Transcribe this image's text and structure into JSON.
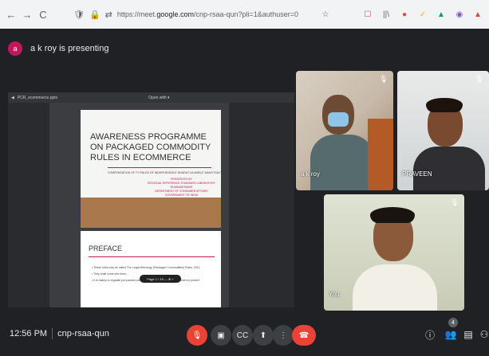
{
  "browser": {
    "url_prefix": "https://meet.",
    "url_domain": "google.com",
    "url_suffix": "/cnp-rsaa-qun?pli=1&authuser=0",
    "back_glyph": "←",
    "forward_glyph": "→",
    "reload_glyph": "C",
    "star_glyph": "☆",
    "extensions": [
      {
        "name": "pocket",
        "glyph": "☐",
        "color": "#d0465a"
      },
      {
        "name": "library",
        "glyph": "||\\",
        "color": "#5f6368"
      },
      {
        "name": "extension-1",
        "glyph": "●",
        "color": "#e8453c"
      },
      {
        "name": "extension-2",
        "glyph": "✓",
        "color": "#f4b400"
      },
      {
        "name": "extension-3",
        "glyph": "▲",
        "color": "#0f9d58"
      },
      {
        "name": "extension-4",
        "glyph": "◉",
        "color": "#7e57c2"
      },
      {
        "name": "extension-5",
        "glyph": "▲",
        "color": "#ea4335"
      }
    ]
  },
  "presenting": {
    "avatar_letter": "a",
    "text": "a k roy is presenting"
  },
  "presentation": {
    "pdf_tab": "PCR_ecommerce.pptx",
    "open_with": "Open with ▾",
    "slide_title": "AWARENESS PROGRAMME ON PACKAGED COMMODITY RULES IN ECOMMERCE",
    "slide_subtitle": "COMPENSATION OF TY RULES OF INDEPENDENCE 'BHARAT KA AMRUT MAHOTSAV'",
    "slide_presenters": [
      "PRESENTED BY",
      "REGIONAL REFERENCE STANDARD LABORATORY",
      "BHUBANESWAR",
      "DEPARTMENT OF CONSUMER AFFAIRS",
      "GOVERNMENT OF INDIA"
    ],
    "page2_title": "PREFACE",
    "page2_lines": [
      "• These rules may be called The Legal Metrology (Packaged Commodities) Rules, 2011.",
      "• They shall come into force...",
      "• It is mainly to regulate pre-packed commodities in the interest of consumers to protect"
    ],
    "zoom_bar": "Page  1  /  19   —  ⊕  +"
  },
  "participants": [
    {
      "name": "a k roy",
      "muted": true
    },
    {
      "name": "PRAVEEN",
      "muted": true
    },
    {
      "name": "You",
      "muted": true
    }
  ],
  "controls": {
    "time": "12:56 PM",
    "meeting_code": "cnp-rsaa-qun",
    "people_count": "4"
  },
  "colors": {
    "meet_dark": "#202124",
    "control_gray": "#3c4043",
    "danger_red": "#ea4335",
    "avatar_pink": "#c2185b"
  }
}
